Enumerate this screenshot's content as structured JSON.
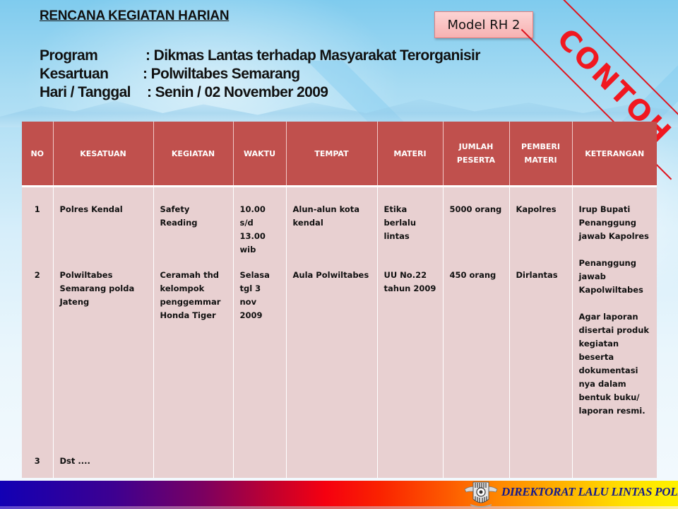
{
  "document": {
    "title": "RENCANA KEGIATAN HARIAN",
    "fields": [
      {
        "label": "Program",
        "value": ": Dikmas Lantas terhadap Masyarakat Terorganisir"
      },
      {
        "label": "Kesartuan",
        "value": ": Polwiltabes  Semarang"
      },
      {
        "label": "Hari / Tanggal",
        "value": ": Senin /  02 November 2009"
      }
    ],
    "model_badge": "Model RH 2",
    "stamp": "CONTOH"
  },
  "table": {
    "headers": [
      "NO",
      "KESATUAN",
      "KEGIATAN",
      "WAKTU",
      "TEMPAT",
      "MATERI",
      "JUMLAH PESERTA",
      "PEMBERI MATERI",
      "KETERANGAN"
    ],
    "rows": [
      {
        "no": "1",
        "kesatuan": "Polres Kendal",
        "kegiatan": "Safety Reading",
        "waktu": "10.00 s/d 13.00 wib",
        "tempat": "Alun-alun kota kendal",
        "materi": "Etika berlalu lintas",
        "jumlah_peserta": "5000 orang",
        "pemberi_materi": "Kapolres"
      },
      {
        "no": "2",
        "kesatuan": "Polwiltabes Semarang polda Jateng",
        "kegiatan": "Ceramah  thd kelompok penggemmar Honda Tiger",
        "waktu": "Selasa tgl 3 nov 2009",
        "tempat": "Aula Polwiltabes",
        "materi": "UU No.22 tahun 2009",
        "jumlah_peserta": "450 orang",
        "pemberi_materi": "Dirlantas"
      },
      {
        "no": "3",
        "kesatuan": "Dst ...."
      }
    ],
    "keterangan": [
      "Irup Bupati Penanggung jawab Kapolres",
      "Penanggung jawab Kapolwiltabes",
      "Agar laporan disertai produk kegiatan beserta dokumentasi nya dalam bentuk buku/ laporan resmi."
    ]
  },
  "footer": {
    "organization": "DIREKTORAT LALU LINTAS POLRI",
    "logo_icon": "police-emblem-icon"
  },
  "colors": {
    "header_fill": "#c0504d",
    "body_fill": "#e8d0d1",
    "stamp": "#f01820",
    "footer_text": "#141a8c"
  }
}
